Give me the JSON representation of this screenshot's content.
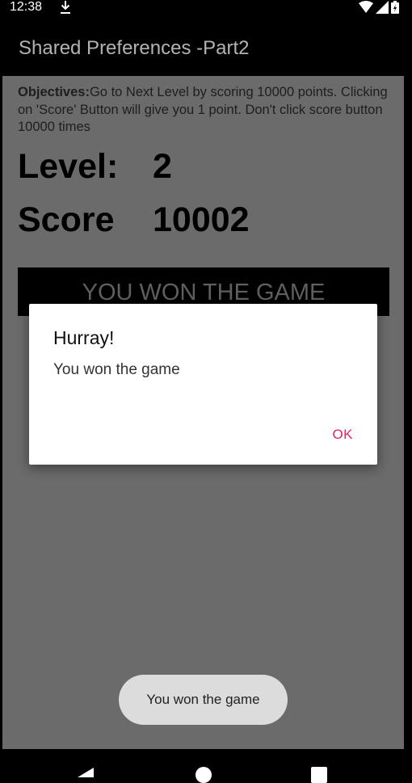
{
  "status_bar": {
    "time": "12:38",
    "icons": [
      "download-icon",
      "wifi-icon",
      "signal-icon",
      "battery-icon"
    ]
  },
  "app_bar": {
    "title": "Shared Preferences -Part2"
  },
  "main": {
    "objectives_label": "Objectives:",
    "objectives_text": "Go to Next Level by scoring 10000 points.  Clicking on 'Score' Button will give you 1 point. Don't click score button 10000 times",
    "level_label": "Level:",
    "level_value": "2",
    "score_label": "Score",
    "score_value": "10002",
    "won_button_label": "YOU WON THE GAME"
  },
  "dialog": {
    "title": "Hurray!",
    "message": "You won the game",
    "ok_label": "OK"
  },
  "toast": {
    "text": "You won the game"
  },
  "nav_bar": {
    "icons": [
      "back-icon",
      "home-icon",
      "recents-icon"
    ]
  },
  "colors": {
    "accent": "#e91e63",
    "content_background": "#6b6b6b",
    "app_bar": "#000000"
  }
}
